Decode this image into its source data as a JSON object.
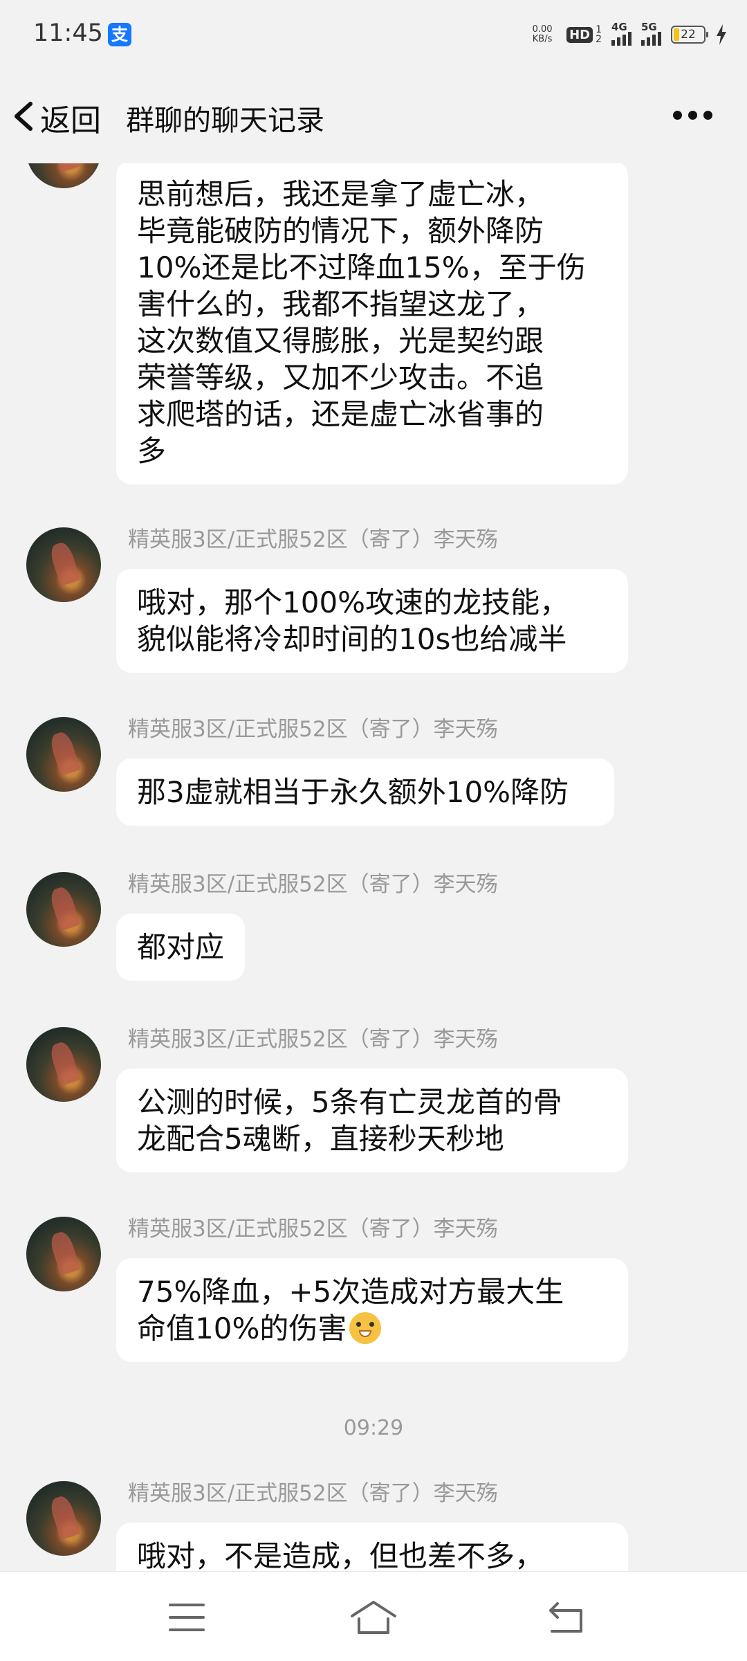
{
  "status_bar": {
    "time": "11:45",
    "app_icon": "alipay-icon",
    "net_speed_value": "0.00",
    "net_speed_unit": "KB/s",
    "hd_label": "HD",
    "hd_sub_top": "1",
    "hd_sub_bottom": "2",
    "signal_1_label": "4G",
    "signal_2_label": "5G",
    "battery": "22"
  },
  "header": {
    "back_label": "返回",
    "title": "群聊的聊天记录"
  },
  "messages": [
    {
      "sender": "",
      "text": "思前想后，我还是拿了虚亡冰，\n毕竟能破防的情况下，额外降防\n10%还是比不过降血15%，至于伤\n害什么的，我都不指望这龙了，\n这次数值又得膨胀，光是契约跟\n荣誉等级，又加不少攻击。不追\n求爬塔的话，还是虚亡冰省事的\n多"
    },
    {
      "sender": "精英服3区/正式服52区（寄了）李天殇",
      "text": "哦对，那个100%攻速的龙技能，\n貌似能将冷却时间的10s也给减半"
    },
    {
      "sender": "精英服3区/正式服52区（寄了）李天殇",
      "text": "那3虚就相当于永久额外10%降防"
    },
    {
      "sender": "精英服3区/正式服52区（寄了）李天殇",
      "text": "都对应"
    },
    {
      "sender": "精英服3区/正式服52区（寄了）李天殇",
      "text": "公测的时候，5条有亡灵龙首的骨\n龙配合5魂断，直接秒天秒地"
    },
    {
      "sender": "精英服3区/正式服52区（寄了）李天殇",
      "text": "75%降血，+5次造成对方最大生\n命值10%的伤害",
      "emoji": "doge-emoji"
    },
    {
      "sender": "精英服3区/正式服52区（寄了）李天殇",
      "text": "哦对，不是造成，但也差不多，"
    }
  ],
  "time_separator": "09:29",
  "nav_bar": {
    "menu_icon": "menu-icon",
    "home_icon": "home-icon",
    "back_icon": "back-icon"
  }
}
